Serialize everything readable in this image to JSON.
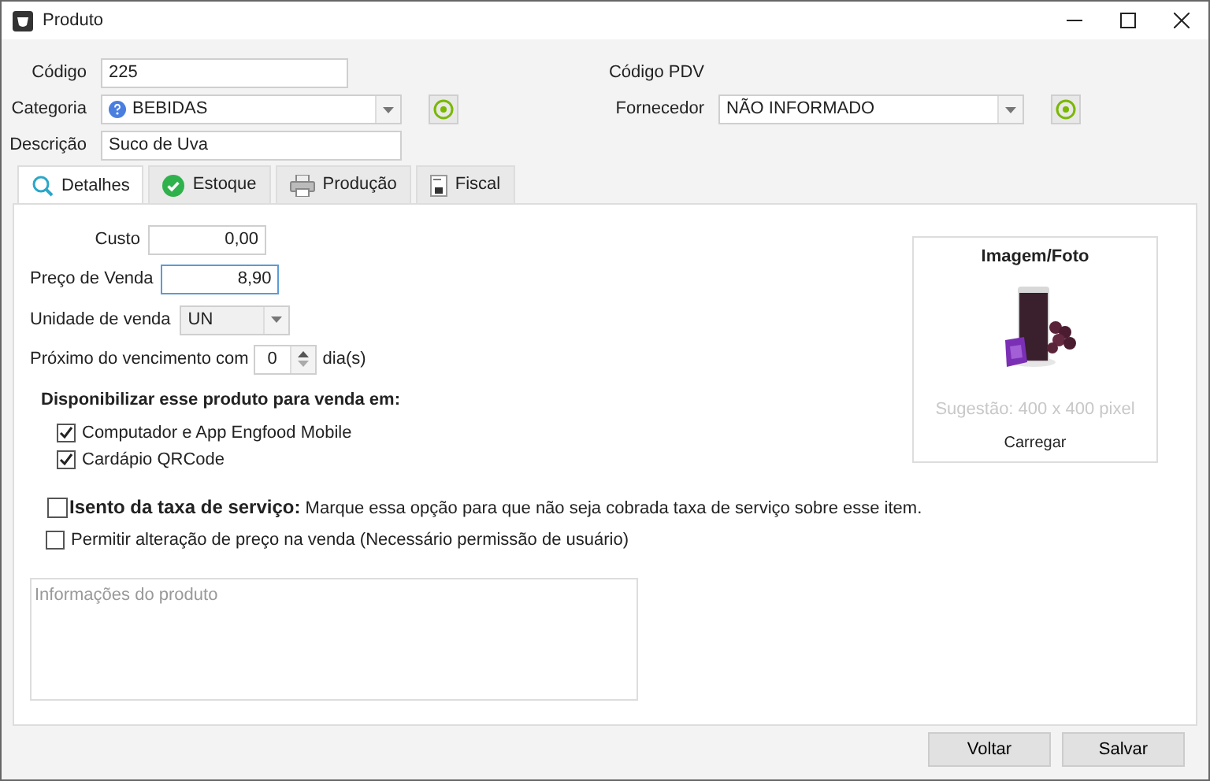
{
  "window": {
    "title": "Produto"
  },
  "header": {
    "codigo": {
      "label": "Código",
      "value": "225"
    },
    "categoria": {
      "label": "Categoria",
      "value": "BEBIDAS"
    },
    "descricao": {
      "label": "Descrição",
      "value": "Suco de Uva"
    },
    "codigo_pdv": {
      "label": "Código PDV"
    },
    "fornecedor": {
      "label": "Fornecedor",
      "value": "NÃO INFORMADO"
    }
  },
  "tabs": [
    {
      "label": "Detalhes",
      "selected": true
    },
    {
      "label": "Estoque",
      "selected": false
    },
    {
      "label": "Produção",
      "selected": false
    },
    {
      "label": "Fiscal",
      "selected": false
    }
  ],
  "details": {
    "custo": {
      "label": "Custo",
      "value": "0,00",
      "focused": false
    },
    "preco_venda": {
      "label": "Preço de Venda",
      "value": "8,90",
      "focused": true
    },
    "unidade": {
      "label": "Unidade de venda",
      "value": "UN"
    },
    "vencimento": {
      "label": "Próximo do vencimento com",
      "value": "0",
      "suffix": "dia(s)"
    },
    "venda": {
      "title": "Disponibilizar esse produto para venda em:",
      "options": [
        {
          "label": "Computador e App Engfood Mobile",
          "checked": true
        },
        {
          "label": "Cardápio QRCode",
          "checked": true
        }
      ]
    },
    "isento": {
      "checked": false,
      "title": "Isento da taxa de serviço:",
      "text": "Marque essa opção para que não seja cobrada taxa de serviço sobre esse item."
    },
    "permitir": {
      "checked": false,
      "label": "Permitir alteração de preço na venda (Necessário permissão de usuário)"
    },
    "informacoes": {
      "placeholder": "Informações do produto"
    },
    "image": {
      "title": "Imagem/Foto",
      "hint": "Sugestão: 400 x 400 pixel",
      "action": "Carregar"
    }
  },
  "buttons": [
    "Voltar",
    "Salvar"
  ]
}
